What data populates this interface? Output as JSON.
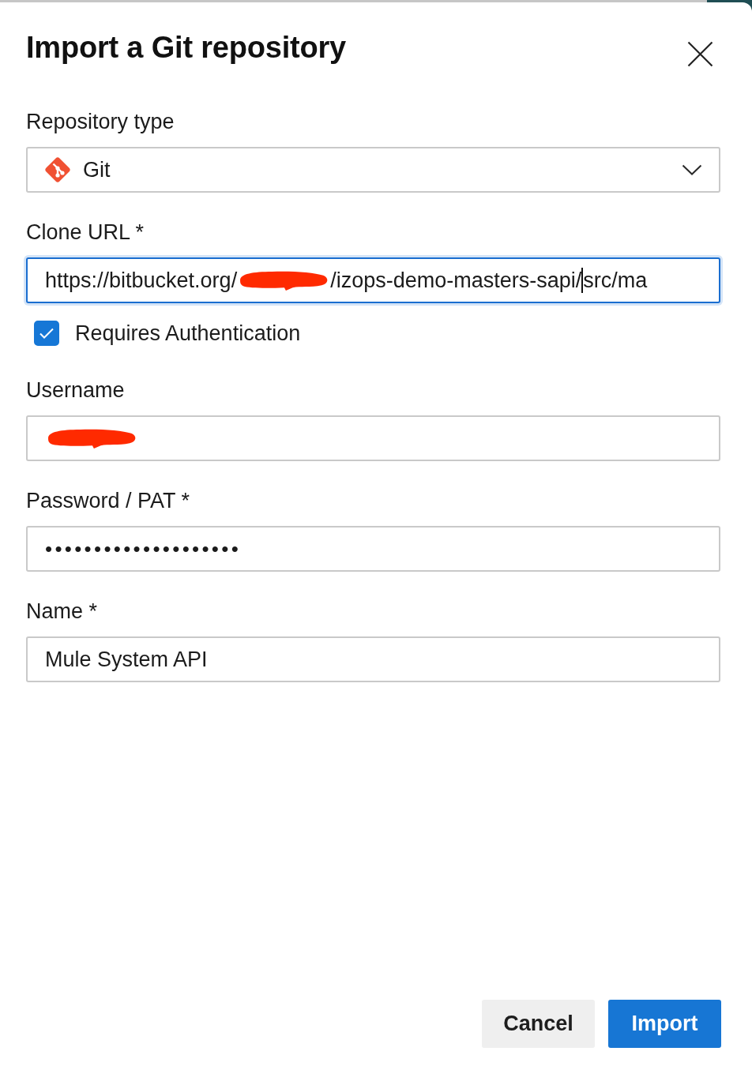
{
  "dialog": {
    "title": "Import a Git repository"
  },
  "fields": [
    {
      "kind": "select",
      "label": "Repository type",
      "value": "Git"
    },
    {
      "kind": "text",
      "label": "Clone URL *",
      "focused": true,
      "segments": [
        {
          "kind": "text",
          "text": "https://bitbucket.org/"
        },
        {
          "kind": "redaction"
        },
        {
          "kind": "text",
          "text": "/izops-demo-masters-sapi/"
        },
        {
          "kind": "cursor"
        },
        {
          "kind": "text",
          "text": "src/ma"
        }
      ]
    },
    {
      "kind": "checkbox",
      "label": "Requires Authentication",
      "checked": true
    },
    {
      "kind": "text",
      "label": "Username",
      "focused": false,
      "segments": [
        {
          "kind": "redaction"
        }
      ]
    },
    {
      "kind": "text",
      "label": "Password / PAT *",
      "focused": false,
      "segments": [
        {
          "kind": "text",
          "text": "••••••••••••••••••••"
        }
      ]
    },
    {
      "kind": "text",
      "label": "Name *",
      "focused": false,
      "segments": [
        {
          "kind": "text",
          "text": "Mule System API"
        }
      ]
    }
  ],
  "buttons": [
    {
      "kind": "cancel",
      "label": "Cancel"
    },
    {
      "kind": "submit",
      "label": "Import"
    }
  ]
}
